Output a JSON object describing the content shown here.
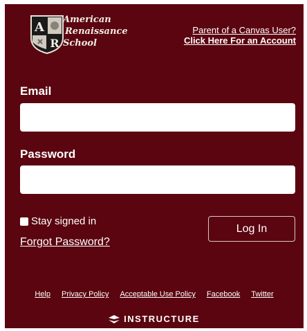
{
  "logo": {
    "line1": "American",
    "line2": "Renaissance",
    "line3": "School",
    "crest_letters": [
      "A",
      "R"
    ]
  },
  "parent": {
    "line1": "Parent of a Canvas User?",
    "line2": "Click Here For an Account"
  },
  "form": {
    "email_label": "Email",
    "email_value": "",
    "password_label": "Password",
    "password_value": "",
    "stay_signed_in": "Stay signed in",
    "forgot_password": "Forgot Password?",
    "login_button": "Log In"
  },
  "footer": {
    "links": [
      "Help",
      "Privacy Policy",
      "Acceptable Use Policy",
      "Facebook",
      "Twitter"
    ],
    "brand": "INSTRUCTURE"
  },
  "colors": {
    "background": "#5b0510",
    "text": "#ffffff"
  }
}
